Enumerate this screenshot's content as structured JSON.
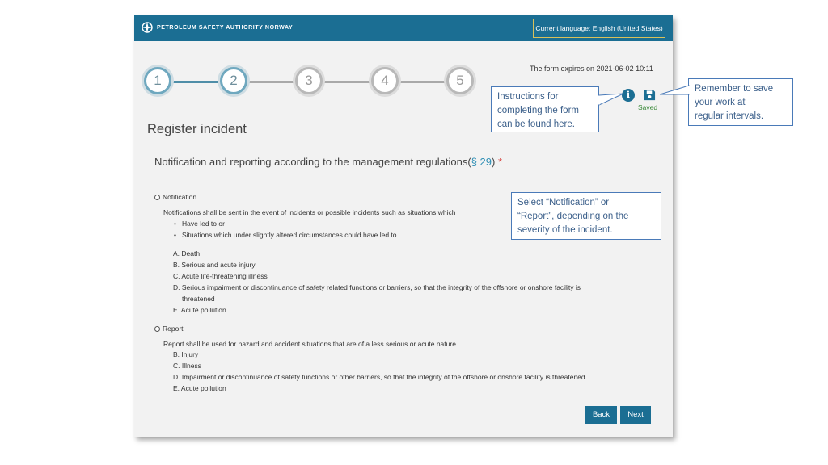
{
  "header": {
    "org_name": "PETROLEUM SAFETY AUTHORITY NORWAY",
    "language_label": "Current language: English (United States)",
    "logo_icon": "psa-compass-logo-icon"
  },
  "stepper": {
    "steps": [
      "1",
      "2",
      "3",
      "4",
      "5"
    ],
    "completed_through": 2
  },
  "form": {
    "expires_text": "The form expires on 2021-06-02 10:11",
    "saved_text": "Saved",
    "page_title": "Register incident",
    "section_title_prefix": "Notification and reporting according to the management regulations(",
    "section_link": "§ 29",
    "section_title_suffix": ")",
    "required_mark": "*",
    "notification": {
      "label": "Notification",
      "description": "Notifications shall be sent in the event of incidents or possible incidents such as situations which",
      "bullets": [
        "Have led to or",
        "Situations which under slightly altered circumstances could have led to"
      ],
      "items": [
        "A. Death",
        "B. Serious and acute injury",
        "C. Acute life-threatening illness",
        "D. Serious impairment or discontinuance of safety related functions or barriers, so that the integrity of the offshore or onshore facility is",
        "threatened",
        "E. Acute pollution"
      ]
    },
    "report": {
      "label": "Report",
      "description": "Report shall be used for hazard and accident situations that are of a less serious or acute nature.",
      "items": [
        "B. Injury",
        "C. Illness",
        "D. Impairment or discontinuance of safety functions or other barriers, so that the integrity of the offshore or onshore facility is threatened",
        "E. Acute pollution"
      ]
    },
    "back_label": "Back",
    "next_label": "Next"
  },
  "callouts": {
    "save_reminder": [
      "Remember to save",
      "your work at",
      "regular intervals."
    ],
    "instructions": [
      "Instructions for",
      "completing the form",
      "can be found here."
    ],
    "select_hint": [
      "Select “Notification” or",
      "“Report”, depending on the",
      "severity of the incident."
    ]
  },
  "colors": {
    "brand_blue": "#1b6e93",
    "callout_border": "#4a7ab8",
    "saved_green": "#3a8a3a"
  }
}
